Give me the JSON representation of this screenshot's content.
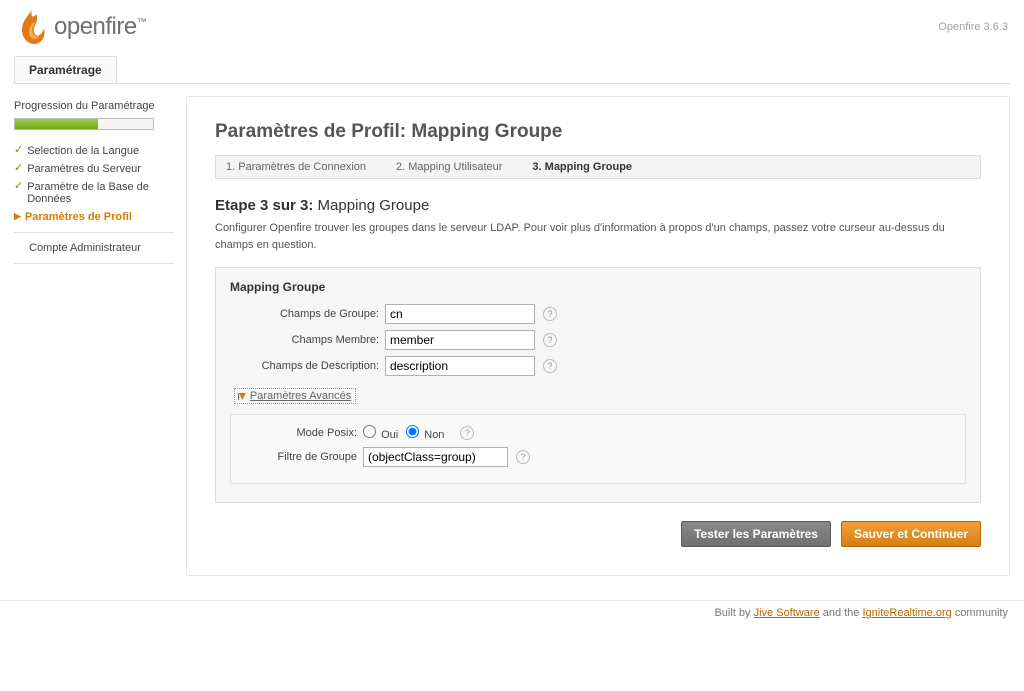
{
  "header": {
    "brand": "openfire",
    "version": "Openfire 3.6.3"
  },
  "tab": {
    "label": "Paramétrage"
  },
  "sidebar": {
    "progress_title": "Progression du Paramétrage",
    "progress_pct": 60,
    "items": [
      {
        "label": "Selection de la Langue",
        "done": true
      },
      {
        "label": "Paramètres du Serveur",
        "done": true
      },
      {
        "label": "Paramètre de la Base de Données",
        "done": true
      },
      {
        "label": "Paramètres de Profil",
        "current": true
      },
      {
        "label": "Compte Administrateur"
      }
    ]
  },
  "main": {
    "title": "Paramètres de Profil: Mapping Groupe",
    "steps": [
      "1. Paramètres de Connexion",
      "2. Mapping Utilisateur",
      "3. Mapping Groupe"
    ],
    "step_active_index": 2,
    "step_heading_bold": "Etape 3 sur 3:",
    "step_heading_rest": "Mapping Groupe",
    "step_desc": "Configurer Openfire trouver les groupes dans le serveur LDAP. Pour voir plus d'information à propos d'un champs, passez votre curseur au-dessus du champs en question.",
    "formbox_title": "Mapping Groupe",
    "fields": {
      "group_label": "Champs de Groupe:",
      "group_value": "cn",
      "member_label": "Champs Membre:",
      "member_value": "member",
      "desc_label": "Champs de Description:",
      "desc_value": "description"
    },
    "advanced_toggle": "Paramètres Avancés",
    "advanced": {
      "posix_label": "Mode Posix:",
      "posix_yes": "Oui",
      "posix_no": "Non",
      "posix_selected": "no",
      "filter_label": "Filtre de Groupe",
      "filter_value": "(objectClass=group)"
    },
    "buttons": {
      "test": "Tester les Paramètres",
      "save": "Sauver et Continuer"
    }
  },
  "footer": {
    "built_by": "Built by ",
    "link1": "Jive Software",
    "middle": " and the ",
    "link2": "IgniteRealtime.org",
    "suffix": " community"
  }
}
